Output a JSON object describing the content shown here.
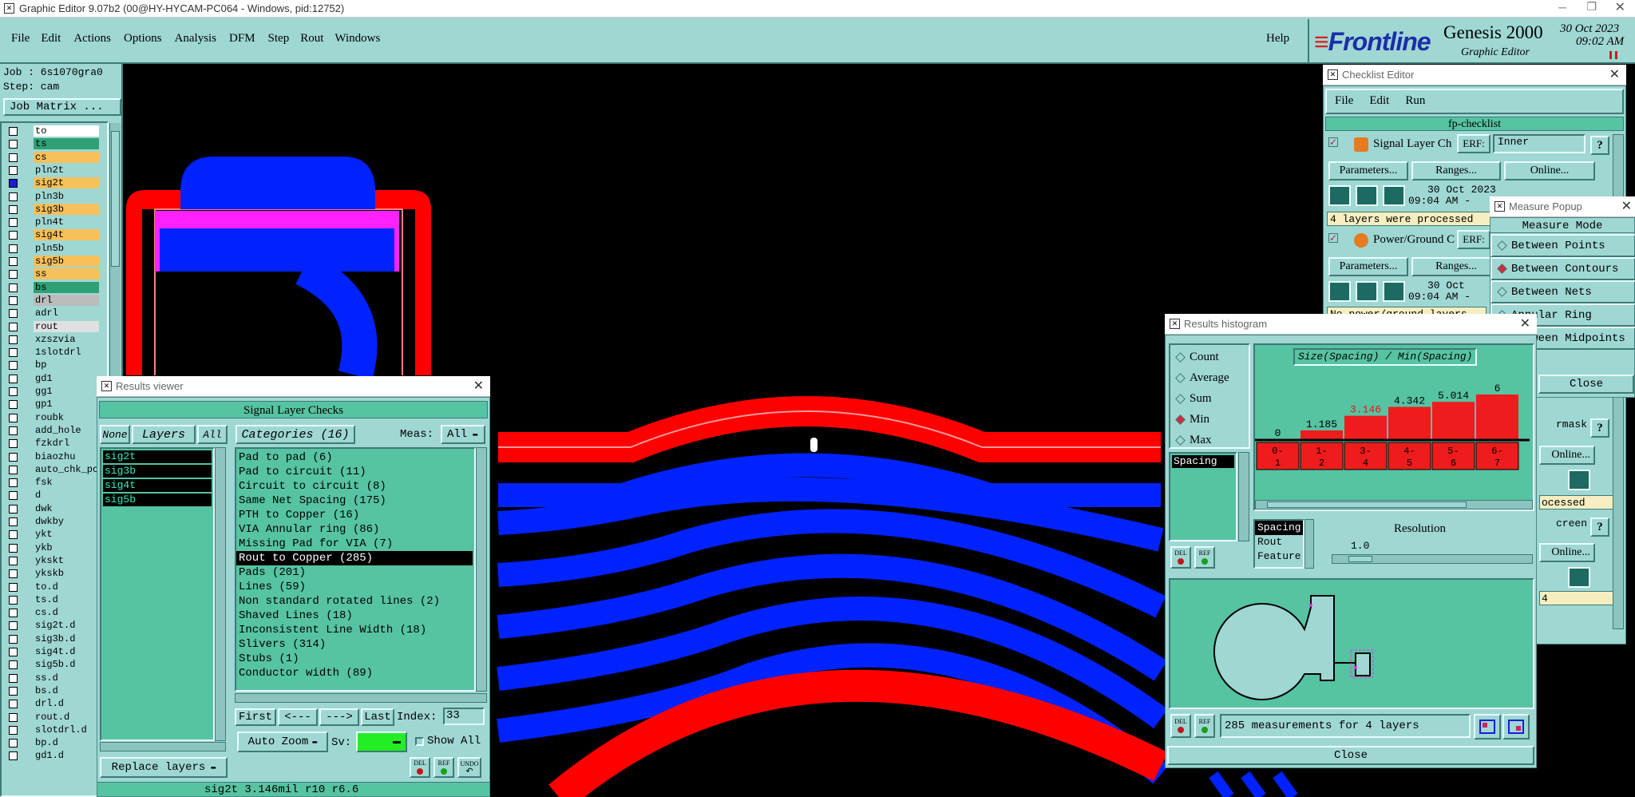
{
  "window": {
    "title": "Graphic Editor 9.07b2 (00@HY-HYCAM-PC064 - Windows, pid:12752)"
  },
  "menu": {
    "items": [
      "File",
      "Edit",
      "Actions",
      "Options",
      "Analysis",
      "DFM",
      "Step",
      "Rout",
      "Windows"
    ],
    "help": "Help"
  },
  "brand": {
    "logo": "Frontline",
    "product": "Genesis 2000",
    "subtitle": "Graphic Editor",
    "date": "30 Oct 2023",
    "time": "09:02 AM"
  },
  "job": {
    "job_label": "Job : 6s1070gra0",
    "step_label": "Step: cam",
    "matrix_button": "Job Matrix ..."
  },
  "layers": [
    {
      "name": "to",
      "color": "#ffffff",
      "check": false
    },
    {
      "name": "ts",
      "color": "#2f9f74",
      "check": false
    },
    {
      "name": "cs",
      "color": "#f6c05a",
      "check": false
    },
    {
      "name": "pln2t",
      "color": "#9fd7d3",
      "check": false
    },
    {
      "name": "sig2t",
      "color": "#f6c05a",
      "check": true
    },
    {
      "name": "pln3b",
      "color": "#9fd7d3",
      "check": false
    },
    {
      "name": "sig3b",
      "color": "#f6c05a",
      "check": false
    },
    {
      "name": "pln4t",
      "color": "#9fd7d3",
      "check": false
    },
    {
      "name": "sig4t",
      "color": "#f6c05a",
      "check": false
    },
    {
      "name": "pln5b",
      "color": "#9fd7d3",
      "check": false
    },
    {
      "name": "sig5b",
      "color": "#f6c05a",
      "check": false
    },
    {
      "name": "ss",
      "color": "#f6c05a",
      "check": false
    },
    {
      "name": "bs",
      "color": "#2f9f74",
      "check": false
    },
    {
      "name": "drl",
      "color": "#bcbcbc",
      "check": false
    },
    {
      "name": "adrl",
      "color": "#9fd7d3",
      "check": false
    },
    {
      "name": "rout",
      "color": "#e0e0e0",
      "check": false
    },
    {
      "name": "xzszvia",
      "color": "#9fd7d3",
      "check": false
    },
    {
      "name": "1slotdrl",
      "color": "#9fd7d3",
      "check": false
    },
    {
      "name": "bp",
      "color": "#9fd7d3",
      "check": false
    },
    {
      "name": "gd1",
      "color": "#9fd7d3",
      "check": false
    },
    {
      "name": "gg1",
      "color": "#9fd7d3",
      "check": false
    },
    {
      "name": "gp1",
      "color": "#9fd7d3",
      "check": false
    },
    {
      "name": "roubk",
      "color": "#9fd7d3",
      "check": false
    },
    {
      "name": "add_hole",
      "color": "#9fd7d3",
      "check": false
    },
    {
      "name": "fzkdrl",
      "color": "#9fd7d3",
      "check": false
    },
    {
      "name": "biaozhu",
      "color": "#9fd7d3",
      "check": false
    },
    {
      "name": "auto_chk_pcs",
      "color": "#9fd7d3",
      "check": false
    },
    {
      "name": "fsk",
      "color": "#9fd7d3",
      "check": false
    },
    {
      "name": "d",
      "color": "#9fd7d3",
      "check": false
    },
    {
      "name": "dwk",
      "color": "#9fd7d3",
      "check": false
    },
    {
      "name": "dwkby",
      "color": "#9fd7d3",
      "check": false
    },
    {
      "name": "ykt",
      "color": "#9fd7d3",
      "check": false
    },
    {
      "name": "ykb",
      "color": "#9fd7d3",
      "check": false
    },
    {
      "name": "ykskt",
      "color": "#9fd7d3",
      "check": false
    },
    {
      "name": "ykskb",
      "color": "#9fd7d3",
      "check": false
    },
    {
      "name": "to.d",
      "color": "#9fd7d3",
      "check": false
    },
    {
      "name": "ts.d",
      "color": "#9fd7d3",
      "check": false
    },
    {
      "name": "cs.d",
      "color": "#9fd7d3",
      "check": false
    },
    {
      "name": "sig2t.d",
      "color": "#9fd7d3",
      "check": false
    },
    {
      "name": "sig3b.d",
      "color": "#9fd7d3",
      "check": false
    },
    {
      "name": "sig4t.d",
      "color": "#9fd7d3",
      "check": false
    },
    {
      "name": "sig5b.d",
      "color": "#9fd7d3",
      "check": false
    },
    {
      "name": "ss.d",
      "color": "#9fd7d3",
      "check": false
    },
    {
      "name": "bs.d",
      "color": "#9fd7d3",
      "check": false
    },
    {
      "name": "drl.d",
      "color": "#9fd7d3",
      "check": false
    },
    {
      "name": "rout.d",
      "color": "#9fd7d3",
      "check": false
    },
    {
      "name": "slotdrl.d",
      "color": "#9fd7d3",
      "check": false
    },
    {
      "name": "bp.d",
      "color": "#9fd7d3",
      "check": false
    },
    {
      "name": "gd1.d",
      "color": "#9fd7d3",
      "check": false
    }
  ],
  "results_viewer": {
    "title": "Results viewer",
    "header": "Signal Layer Checks",
    "none_btn": "None",
    "layers_btn": "Layers",
    "all_btn": "All",
    "layer_list": [
      "sig2t",
      "sig3b",
      "sig4t",
      "sig5b"
    ],
    "categories_label": "Categories (16)",
    "meas_label": "Meas:",
    "meas_value": "All",
    "categories": [
      "Pad to pad (6)",
      "Pad to circuit (11)",
      "Circuit to circuit (8)",
      "Same Net Spacing (175)",
      "PTH to Copper (16)",
      "VIA Annular ring (86)",
      "Missing Pad for VIA (7)",
      "Rout to Copper (285)",
      "Pads (201)",
      "Lines (59)",
      "Non standard rotated lines (2)",
      "Shaved Lines (18)",
      "Inconsistent Line Width (18)",
      "Slivers (314)",
      "Stubs (1)",
      "Conductor width (89)"
    ],
    "selected_category": "Rout to Copper (285)",
    "first": "First",
    "prev": "<---",
    "next": "--->",
    "last": "Last",
    "index_label": "Index:",
    "index_value": "33",
    "auto_zoom": "Auto Zoom",
    "sv_label": "Sv:",
    "show_all": "Show All",
    "replace_layers": "Replace layers",
    "del": "DEL",
    "ref": "REF",
    "undo": "UNDO"
  },
  "status_bar": {
    "text": "sig2t 3.146mil  r10  r6.6"
  },
  "checklist": {
    "title": "Checklist Editor",
    "menu": [
      "File",
      "Edit",
      "Run"
    ],
    "name": "fp-checklist",
    "items": [
      {
        "name": "Signal Layer Ch",
        "erf_label": "ERF:",
        "erf_value": "Inner",
        "date": "30 Oct 2023",
        "time": "09:04 AM -",
        "status": "4 layers were processed"
      },
      {
        "name": "Power/Ground C",
        "erf_label": "ERF:",
        "date": "30 Oct",
        "time": "09:04 AM -",
        "status": "No power/ground layers"
      }
    ],
    "parameters": "Parameters...",
    "ranges": "Ranges...",
    "online": "Online...",
    "help_q": "?"
  },
  "measure_popup": {
    "title": "Measure Popup",
    "mode_header": "Measure Mode",
    "modes": [
      "Between Points",
      "Between Contours",
      "Between Nets",
      "Annular Ring",
      "Between Midpoints"
    ],
    "selected": "Between Contours",
    "close": "Close"
  },
  "checklist_right_fragments": {
    "mask": "rmask",
    "online1": "Online...",
    "online2": "Online...",
    "processed": "ocessed",
    "screen": "creen",
    "last": "4"
  },
  "histogram": {
    "title": "Results histogram",
    "options": [
      "Count",
      "Average",
      "Sum",
      "Min",
      "Max"
    ],
    "selected_option": "Min",
    "heading": "Size(Spacing) / Min(Spacing)",
    "list_item": "Spacing",
    "del": "DEL",
    "ref": "REF",
    "sort_options": [
      "Spacing",
      "Rout",
      "Feature"
    ],
    "resolution_label": "Resolution",
    "resolution_value": "1.0",
    "summary": "285 measurements for 4 layers",
    "close": "Close"
  },
  "chart_data": {
    "type": "bar",
    "title": "Size(Spacing) / Min(Spacing)",
    "categories": [
      "0-1",
      "1-2",
      "3-4",
      "4-5",
      "5-6",
      "6-7"
    ],
    "category_top": [
      "0-",
      "1-",
      "3-",
      "4-",
      "5-",
      "6-"
    ],
    "category_bottom": [
      "1",
      "2",
      "4",
      "5",
      "6",
      "7"
    ],
    "values": [
      0,
      1.185,
      3.146,
      4.342,
      5.014,
      6
    ],
    "labels": [
      "0",
      "1.185",
      "3.146",
      "4.342",
      "5.014",
      "6"
    ],
    "highlight_index": 2,
    "bar_color": "#ee1c1c",
    "ylim": [
      0,
      6
    ]
  },
  "colors": {
    "accent": "#9fd7d3",
    "panel": "#56c3a3",
    "trace_red": "#ff0000",
    "trace_blue": "#0022ff",
    "pad_magenta": "#ff22ff"
  }
}
